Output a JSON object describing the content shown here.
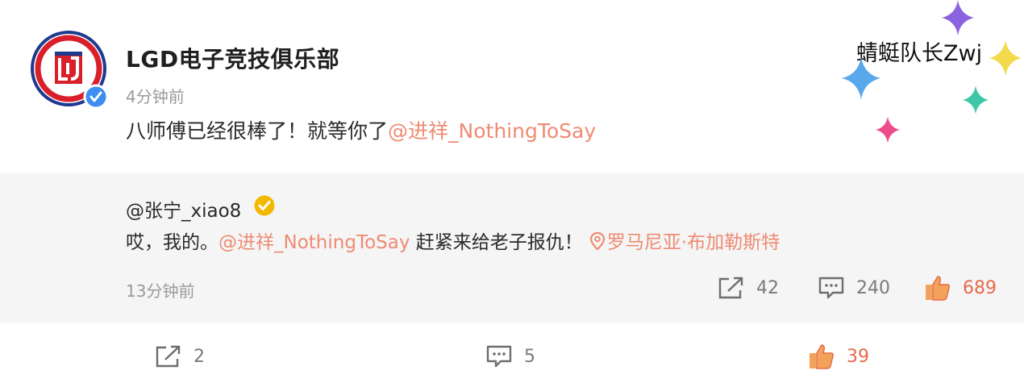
{
  "post": {
    "author": "LGD电子竞技俱乐部",
    "time": "4分钟前",
    "text": "八师傅已经很棒了！就等你了",
    "mention": "@进祥_NothingToSay"
  },
  "watermark": {
    "text": "蜻蜓队长Zwj"
  },
  "repost": {
    "author": "@张宁_xiao8",
    "text_before": "哎，我的。",
    "mention": "@进祥_NothingToSay",
    "text_after": " 赶紧来给老子报仇！",
    "location": "罗马尼亚·布加勒斯特",
    "time": "13分钟前",
    "share_count": "42",
    "comment_count": "240",
    "like_count": "689"
  },
  "footer": {
    "share_count": "2",
    "comment_count": "5",
    "like_count": "39"
  },
  "colors": {
    "mention": "#ee8b73",
    "like": "#e86a4b",
    "verified_blue": "#3d8ef0",
    "verified_gold": "#f5b800",
    "repost_bg": "#f5f5f5"
  },
  "icons": [
    "lgd-logo",
    "verified-icon",
    "gold-verified-icon",
    "location-icon",
    "share-icon",
    "comment-icon",
    "like-icon",
    "sparkle-icon"
  ]
}
